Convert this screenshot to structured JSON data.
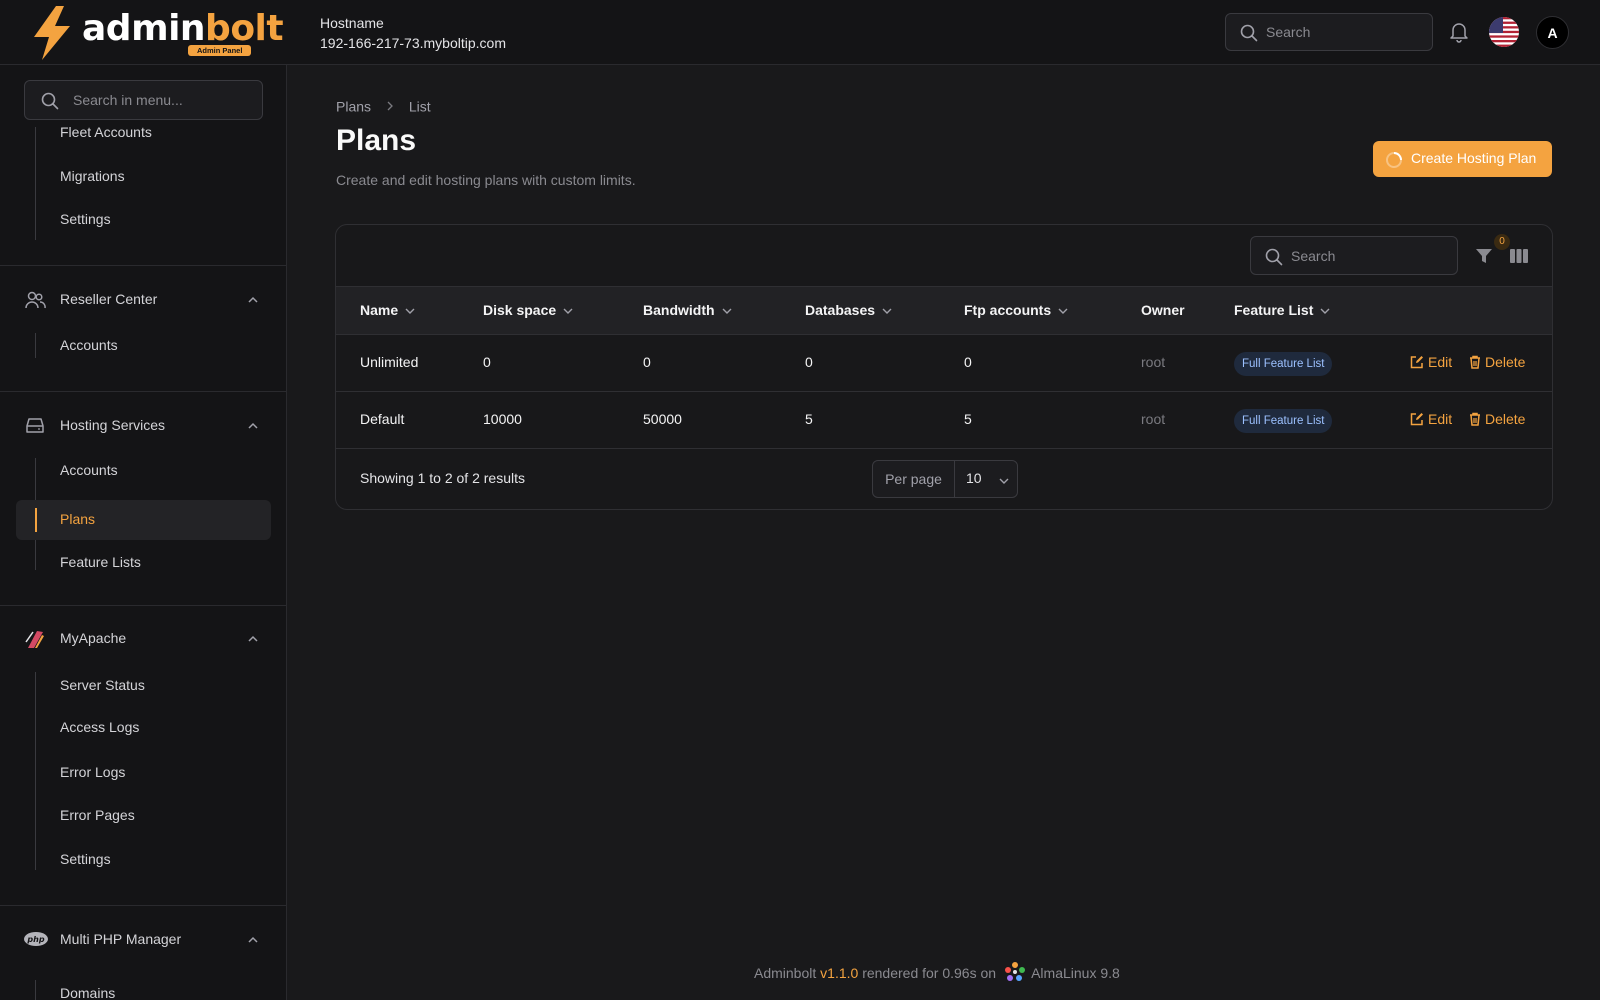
{
  "brand": {
    "name_a": "admin",
    "name_b": "bolt",
    "badge": "Admin Panel"
  },
  "header": {
    "hostname_label": "Hostname",
    "hostname_value": "192-166-217-73.myboltip.com",
    "search_placeholder": "Search",
    "avatar_initial": "A"
  },
  "sidebar": {
    "search_placeholder": "Search in menu...",
    "items": {
      "fleet_accounts": "Fleet Accounts",
      "migrations": "Migrations",
      "settings_1": "Settings",
      "reseller_center": "Reseller Center",
      "reseller_accounts": "Accounts",
      "hosting_services": "Hosting Services",
      "hosting_accounts": "Accounts",
      "plans": "Plans",
      "feature_lists": "Feature Lists",
      "myapache": "MyApache",
      "server_status": "Server Status",
      "access_logs": "Access Logs",
      "error_logs": "Error Logs",
      "error_pages": "Error Pages",
      "settings_2": "Settings",
      "multi_php": "Multi PHP Manager",
      "domains": "Domains"
    }
  },
  "main": {
    "breadcrumb": [
      "Plans",
      "List"
    ],
    "title": "Plans",
    "subtitle": "Create and edit hosting plans with custom limits.",
    "create_button": "Create Hosting Plan",
    "table": {
      "search_placeholder": "Search",
      "filter_count": "0",
      "columns": [
        "Name",
        "Disk space",
        "Bandwidth",
        "Databases",
        "Ftp accounts",
        "Owner",
        "Feature List"
      ],
      "rows": [
        {
          "name": "Unlimited",
          "disk": "0",
          "bandwidth": "0",
          "databases": "0",
          "ftp": "0",
          "owner": "root",
          "feature_list": "Full Feature List",
          "edit": "Edit",
          "delete": "Delete"
        },
        {
          "name": "Default",
          "disk": "10000",
          "bandwidth": "50000",
          "databases": "5",
          "ftp": "5",
          "owner": "root",
          "feature_list": "Full Feature List",
          "edit": "Edit",
          "delete": "Delete"
        }
      ],
      "showing": "Showing 1 to 2 of 2 results",
      "per_page_label": "Per page",
      "per_page_value": "10"
    }
  },
  "footer": {
    "product": "Adminbolt",
    "version": "v1.1.0",
    "rendered": "rendered for 0.96s on",
    "os": "AlmaLinux 9.8"
  },
  "colors": {
    "accent": "#f4a340",
    "background": "#19191b",
    "sidebar": "#141416",
    "pill_bg": "#1f2a3d",
    "pill_text": "#9cc1ff"
  }
}
